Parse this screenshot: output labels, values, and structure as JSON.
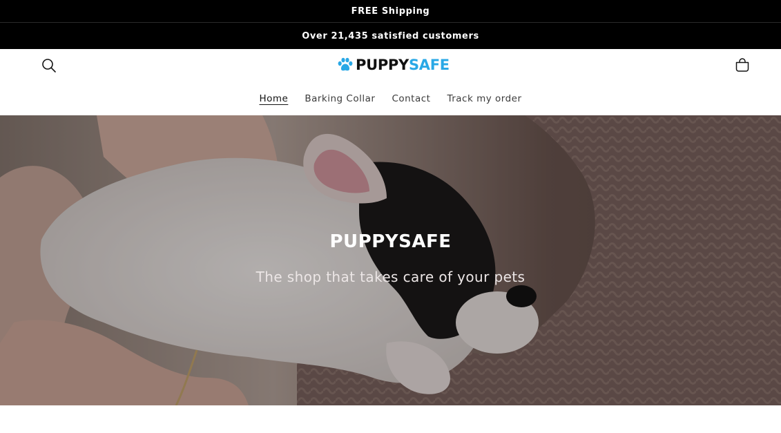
{
  "announcements": [
    {
      "text": "FREE Shipping"
    },
    {
      "text": "Over 21,435 satisfied customers"
    }
  ],
  "header": {
    "logo_part1": "PUPPY",
    "logo_part2": "SAFE",
    "logo_icon": "paw-icon",
    "search_icon": "search-icon",
    "cart_icon": "cart-icon",
    "brand_color": "#29a8e6"
  },
  "nav": {
    "items": [
      {
        "label": "Home",
        "active": true
      },
      {
        "label": "Barking Collar",
        "active": false
      },
      {
        "label": "Contact",
        "active": false
      },
      {
        "label": "Track my order",
        "active": false
      }
    ]
  },
  "hero": {
    "title": "PUPPYSAFE",
    "subtitle": "The shop that takes care of your pets"
  }
}
